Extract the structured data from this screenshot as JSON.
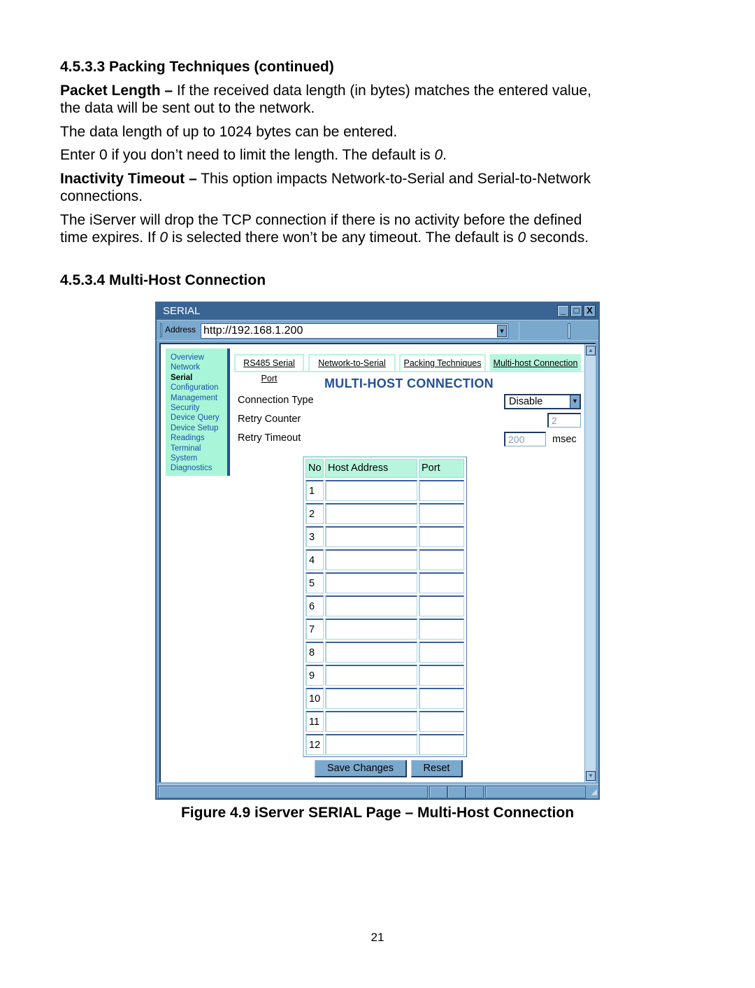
{
  "document": {
    "heading_1": "4.5.3.3  Packing Techniques (continued)",
    "para_packet_length_term": "Packet Length –",
    "para_packet_length_line1": " If the received data length (in bytes) matches the entered value,",
    "para_packet_length_line2": "the data will be sent out to the network.",
    "para_max_length": "The data length of up to 1024 bytes can be entered.",
    "para_enter_zero_prefix": "Enter 0 if you don’t need to limit the length. The default is ",
    "para_enter_zero_value": "0",
    "para_enter_zero_suffix": ".",
    "para_inactivity_term": "Inactivity Timeout –",
    "para_inactivity_line1": " This option impacts Network-to-Serial and Serial-to-Network",
    "para_inactivity_line2": "connections.",
    "para_drop_line1": "The iServer will drop the TCP connection if there is no activity before the defined",
    "para_drop_line2_a": "time expires. If ",
    "para_drop_line2_b": "0",
    "para_drop_line2_c": " is selected there won’t be any timeout. The default is ",
    "para_drop_line2_d": "0",
    "para_drop_line2_e": " seconds.",
    "heading_2": "4.5.3.4  Multi-Host Connection",
    "caption": "Figure 4.9  iServer SERIAL Page – Multi-Host Connection",
    "page_number": "21"
  },
  "window": {
    "title": "SERIAL",
    "buttons": {
      "minimize": "_",
      "maximize": "□",
      "close": "X"
    },
    "address_label": "Address",
    "address_value": "http://192.168.1.200"
  },
  "sidebar": {
    "items": [
      {
        "label": "Overview",
        "active": false
      },
      {
        "label": "Network",
        "active": false
      },
      {
        "label": "Serial",
        "active": true
      },
      {
        "label": "Configuration",
        "active": false
      },
      {
        "label": "Management",
        "active": false
      },
      {
        "label": "Security",
        "active": false
      },
      {
        "label": "Device Query",
        "active": false
      },
      {
        "label": "Device Setup",
        "active": false
      },
      {
        "label": "Readings",
        "active": false
      },
      {
        "label": "Terminal",
        "active": false
      },
      {
        "label": "System",
        "active": false
      },
      {
        "label": "Diagnostics",
        "active": false
      }
    ]
  },
  "tabs": [
    {
      "label": "RS485 Serial Port",
      "active": false
    },
    {
      "label": "Network-to-Serial",
      "active": false
    },
    {
      "label": "Packing Techniques",
      "active": false
    },
    {
      "label": "Multi-host Connection",
      "active": true
    }
  ],
  "form": {
    "section_title": "MULTI-HOST CONNECTION",
    "connection_type_label": "Connection Type",
    "connection_type_value": "Disable",
    "retry_counter_label": "Retry Counter",
    "retry_counter_value": "2",
    "retry_timeout_label": "Retry Timeout",
    "retry_timeout_value": "200",
    "retry_timeout_unit": "msec"
  },
  "host_table": {
    "columns": [
      "No",
      "Host Address",
      "Port"
    ],
    "rows": [
      {
        "no": "1",
        "host": "",
        "port": ""
      },
      {
        "no": "2",
        "host": "",
        "port": ""
      },
      {
        "no": "3",
        "host": "",
        "port": ""
      },
      {
        "no": "4",
        "host": "",
        "port": ""
      },
      {
        "no": "5",
        "host": "",
        "port": ""
      },
      {
        "no": "6",
        "host": "",
        "port": ""
      },
      {
        "no": "7",
        "host": "",
        "port": ""
      },
      {
        "no": "8",
        "host": "",
        "port": ""
      },
      {
        "no": "9",
        "host": "",
        "port": ""
      },
      {
        "no": "10",
        "host": "",
        "port": ""
      },
      {
        "no": "11",
        "host": "",
        "port": ""
      },
      {
        "no": "12",
        "host": "",
        "port": ""
      }
    ]
  },
  "actions": {
    "save_label": "Save Changes",
    "reset_label": "Reset"
  },
  "colors": {
    "window_frame": "#3a6592",
    "chrome": "#7ba9ce",
    "nav_background": "#a9f5d9",
    "nav_link": "#1b4fae",
    "section_title": "#23509a",
    "tab_active": "#b8f5de"
  }
}
